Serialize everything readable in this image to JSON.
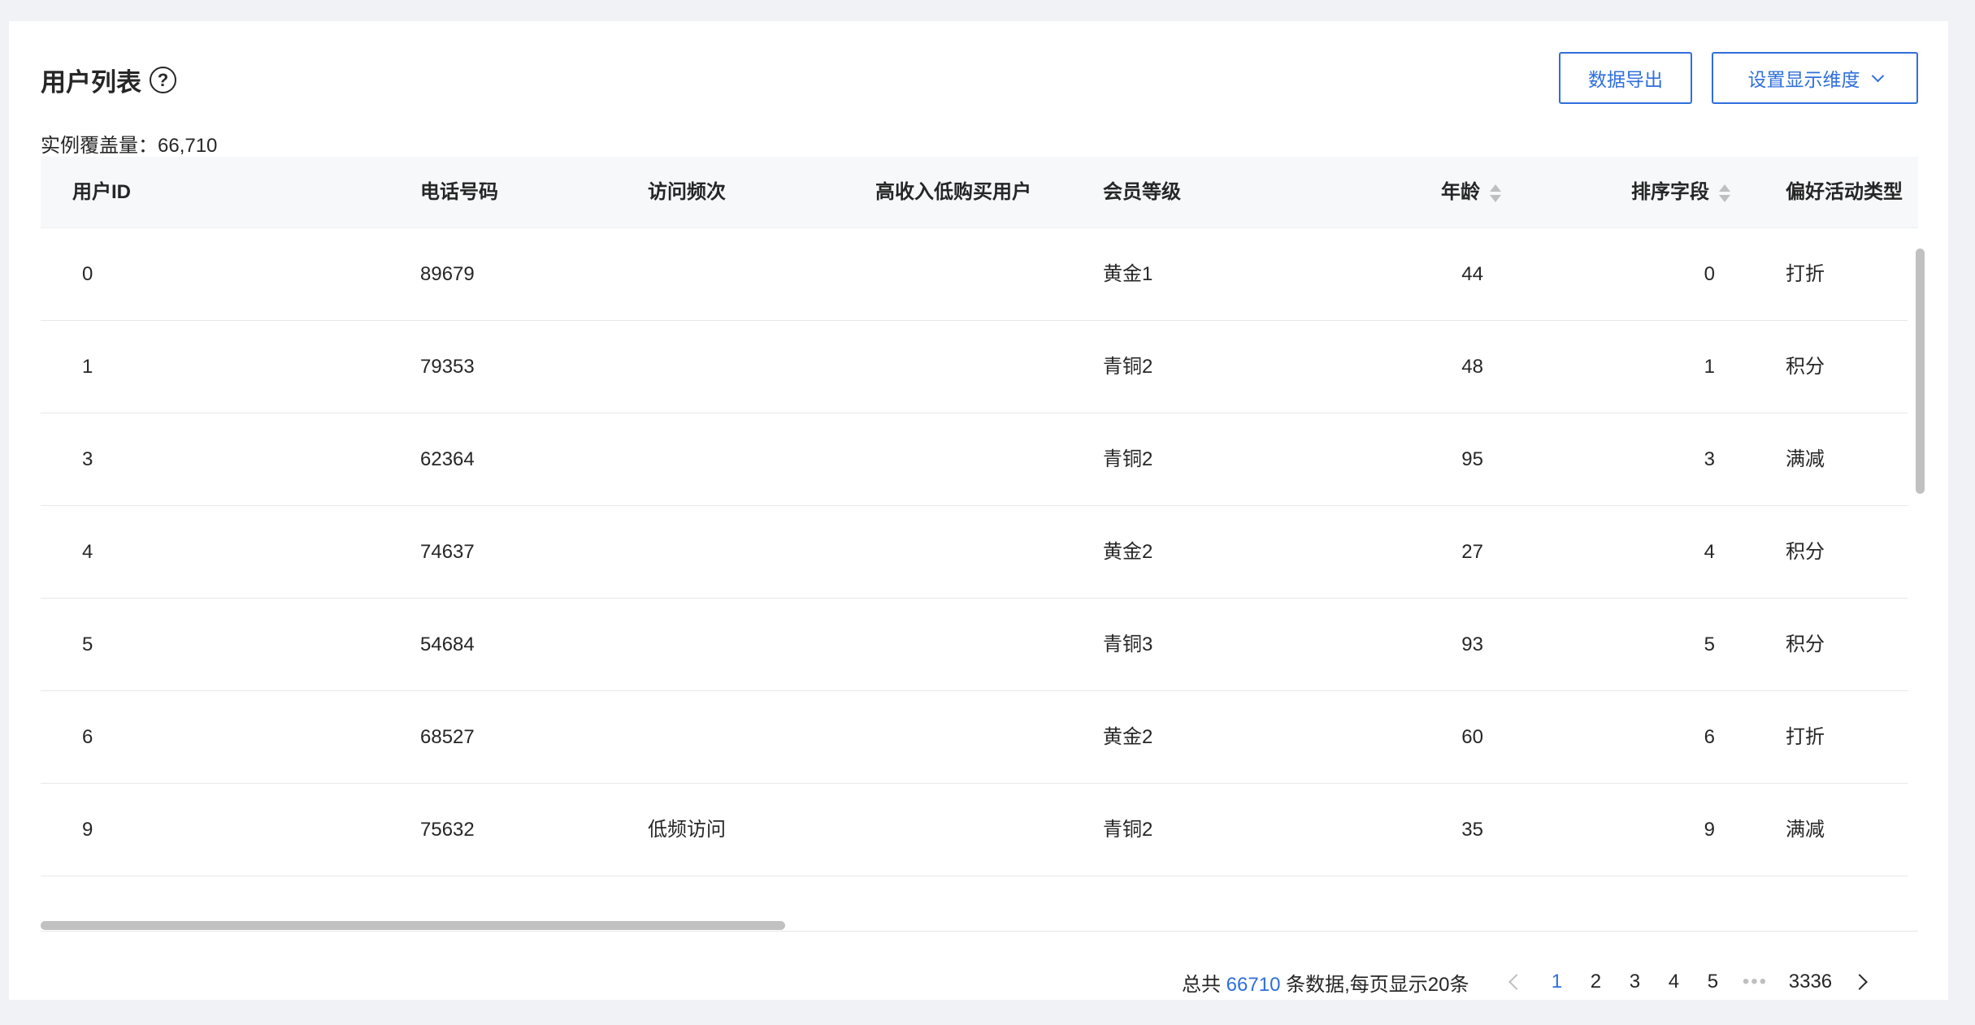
{
  "header": {
    "title": "用户列表",
    "help_icon": "question-circle-icon",
    "export_button": "数据导出",
    "dimensions_button": "设置显示维度"
  },
  "coverage": {
    "text": "实例覆盖量：66,710"
  },
  "table": {
    "columns": [
      "用户ID",
      "电话号码",
      "访问频次",
      "高收入低购买用户",
      "会员等级",
      "年龄",
      "排序字段",
      "偏好活动类型"
    ],
    "rows": [
      [
        "0",
        "89679",
        "",
        "",
        "黄金1",
        "44",
        "0",
        "打折"
      ],
      [
        "1",
        "79353",
        "",
        "",
        "青铜2",
        "48",
        "1",
        "积分"
      ],
      [
        "3",
        "62364",
        "",
        "",
        "青铜2",
        "95",
        "3",
        "满减"
      ],
      [
        "4",
        "74637",
        "",
        "",
        "黄金2",
        "27",
        "4",
        "积分"
      ],
      [
        "5",
        "54684",
        "",
        "",
        "青铜3",
        "93",
        "5",
        "积分"
      ],
      [
        "6",
        "68527",
        "",
        "",
        "黄金2",
        "60",
        "6",
        "打折"
      ],
      [
        "9",
        "75632",
        "低频访问",
        "",
        "青铜2",
        "35",
        "9",
        "满减"
      ]
    ]
  },
  "pagination": {
    "total_prefix": "总共 ",
    "total_count": "66710",
    "total_suffix": " 条数据,每页显示20条",
    "pages": [
      "1",
      "2",
      "3",
      "4",
      "5"
    ],
    "ellipsis": "•••",
    "last_page": "3336",
    "current_page": "1"
  },
  "colors": {
    "accent": "#2f6fdc",
    "header_bg": "#f7f8fa",
    "page_bg": "#f0f2f5"
  }
}
